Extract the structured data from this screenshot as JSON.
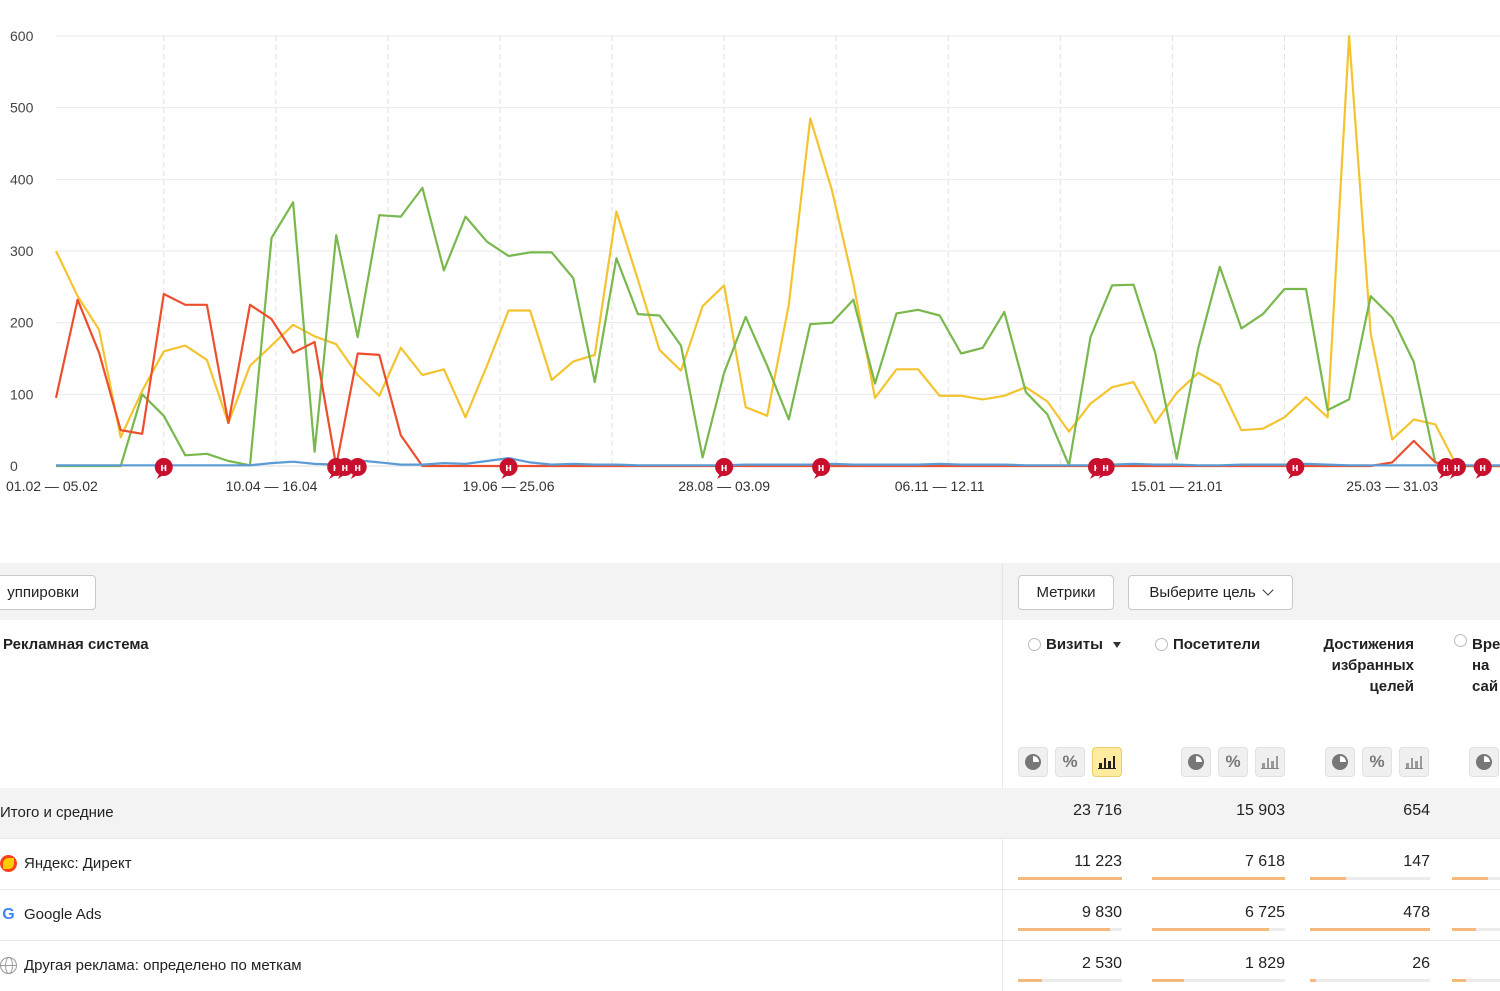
{
  "chart_data": {
    "type": "line",
    "ylim": [
      0,
      600
    ],
    "yticks": [
      0,
      100,
      200,
      300,
      400,
      500,
      600
    ],
    "x_tick_labels": [
      "01.02 — 05.02",
      "10.04 — 16.04",
      "19.06 — 25.06",
      "28.08 — 03.09",
      "06.11 — 12.11",
      "15.01 — 21.01",
      "25.03 — 31.03"
    ],
    "x_count": 68,
    "x_tick_indices": [
      0,
      10,
      21,
      31,
      41,
      52,
      62
    ],
    "grid": true,
    "series": [
      {
        "color": "#f4c430",
        "values": [
          300,
          237,
          190,
          40,
          105,
          160,
          168,
          148,
          60,
          140,
          168,
          197,
          181,
          170,
          127,
          98,
          165,
          127,
          135,
          68,
          140,
          217,
          217,
          120,
          146,
          155,
          355,
          260,
          162,
          133,
          223,
          252,
          82,
          70,
          225,
          485,
          385,
          255,
          95,
          135,
          135,
          98,
          98,
          93,
          98,
          110,
          90,
          48,
          87,
          110,
          117,
          60,
          102,
          130,
          113,
          50,
          52,
          68,
          96,
          68,
          600,
          185,
          37,
          65,
          58,
          0,
          0,
          0
        ]
      },
      {
        "color": "#79b84d",
        "values": [
          0,
          0,
          0,
          0,
          100,
          70,
          15,
          17,
          7,
          1,
          318,
          368,
          20,
          322,
          180,
          350,
          348,
          388,
          273,
          348,
          313,
          293,
          298,
          298,
          262,
          117,
          290,
          212,
          210,
          168,
          12,
          130,
          208,
          140,
          65,
          198,
          200,
          232,
          115,
          213,
          218,
          210,
          157,
          165,
          215,
          103,
          72,
          1,
          180,
          252,
          253,
          158,
          10,
          165,
          278,
          192,
          212,
          247,
          247,
          78,
          93,
          237,
          207,
          145,
          5,
          0,
          0,
          0
        ]
      },
      {
        "color": "#ed4f2e",
        "values": [
          95,
          232,
          158,
          50,
          45,
          240,
          225,
          225,
          60,
          225,
          205,
          158,
          173,
          0,
          157,
          155,
          43,
          0,
          0,
          0,
          0,
          0,
          0,
          0,
          0,
          0,
          0,
          0,
          0,
          0,
          0,
          0,
          0,
          0,
          0,
          0,
          0,
          0,
          0,
          0,
          0,
          0,
          0,
          0,
          0,
          0,
          0,
          0,
          0,
          0,
          0,
          0,
          0,
          0,
          0,
          0,
          0,
          0,
          0,
          0,
          0,
          0,
          5,
          35,
          5,
          0,
          0,
          0
        ]
      },
      {
        "color": "#5b9bd5",
        "values": [
          1,
          1,
          1,
          1,
          1,
          1,
          1,
          1,
          1,
          1,
          4,
          6,
          3,
          2,
          8,
          5,
          2,
          2,
          4,
          3,
          7,
          11,
          5,
          2,
          3,
          2,
          2,
          1,
          1,
          1,
          1,
          1,
          2,
          2,
          2,
          2,
          3,
          2,
          2,
          2,
          2,
          3,
          2,
          2,
          2,
          1,
          1,
          1,
          1,
          2,
          3,
          2,
          2,
          1,
          1,
          2,
          2,
          2,
          3,
          2,
          1,
          1,
          1,
          1,
          1,
          1,
          1,
          1
        ]
      }
    ],
    "annotation_marker_label": "н",
    "annotation_x_indices": [
      5,
      13,
      13.4,
      14,
      21,
      31,
      35.5,
      48.3,
      48.7,
      57.5,
      64.5,
      65,
      66.2
    ]
  },
  "toolbar": {
    "grouping_label": "уппировки",
    "metrics_label": "Метрики",
    "goal_label": "Выберите цель"
  },
  "table": {
    "col_system": "Рекламная система",
    "col_visits": "Визиты",
    "col_visitors": "Посетители",
    "col_goals": "Достижения избранных целей",
    "col_time": "Вре на сай",
    "rows": [
      {
        "label": "Итого и средние",
        "visits": "23 716",
        "visitors": "15 903",
        "goals": "654"
      },
      {
        "label": "Яндекс: Директ",
        "visits": "11 223",
        "visitors": "7 618",
        "goals": "147",
        "visits_share": 1.0,
        "visitors_share": 1.0,
        "goals_share": 0.3,
        "time_share": 0.75
      },
      {
        "label": "Google Ads",
        "visits": "9 830",
        "visitors": "6 725",
        "goals": "478",
        "visits_share": 0.88,
        "visitors_share": 0.88,
        "goals_share": 1.0,
        "time_share": 0.5
      },
      {
        "label": "Другая реклама: определено по меткам",
        "visits": "2 530",
        "visitors": "1 829",
        "goals": "26",
        "visits_share": 0.23,
        "visitors_share": 0.24,
        "goals_share": 0.05,
        "time_share": 0.3
      }
    ]
  }
}
